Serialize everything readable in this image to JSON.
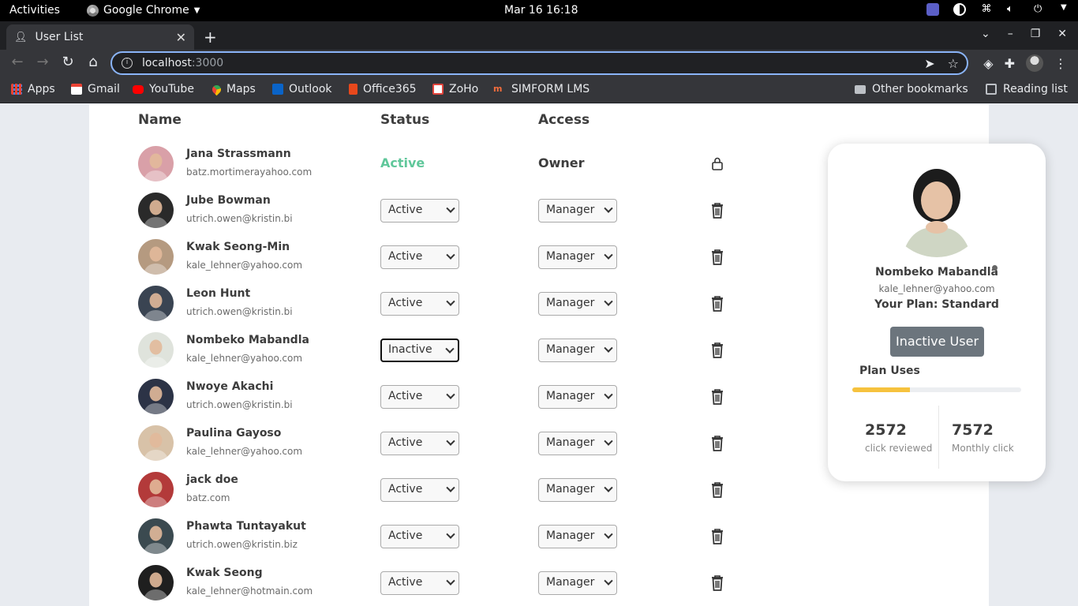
{
  "system_bar": {
    "activities": "Activities",
    "app_name": "Google Chrome",
    "datetime": "Mar 16  16:18"
  },
  "browser": {
    "tab_title": "User List",
    "url_host": "localhost",
    "url_port": ":3000",
    "bookmarks": [
      "Apps",
      "Gmail",
      "YouTube",
      "Maps",
      "Outlook",
      "Office365",
      "ZoHo",
      "SIMFORM LMS"
    ],
    "other_bookmarks": "Other bookmarks",
    "reading_list": "Reading list"
  },
  "table": {
    "headers": {
      "name": "Name",
      "status": "Status",
      "access": "Access"
    },
    "rows": [
      {
        "name": "Jana Strassmann",
        "email": "batz.mortimerayahoo.com",
        "status": "Active",
        "access": "Owner",
        "editable": false,
        "icon": "lock-icon",
        "avatar_color": "#d9a0a8"
      },
      {
        "name": "Jube Bowman",
        "email": "utrich.owen@kristin.bi",
        "status": "Active",
        "access": "Manager",
        "editable": true,
        "icon": "trash-icon",
        "avatar_color": "#2a2a2a"
      },
      {
        "name": "Kwak Seong-Min",
        "email": "kale_lehner@yahoo.com",
        "status": "Active",
        "access": "Manager",
        "editable": true,
        "icon": "trash-icon",
        "avatar_color": "#b59a80"
      },
      {
        "name": "Leon Hunt",
        "email": "utrich.owen@kristin.bi",
        "status": "Active",
        "access": "Manager",
        "editable": true,
        "icon": "trash-icon",
        "avatar_color": "#3a4452"
      },
      {
        "name": "Nombeko Mabandla",
        "email": "kale_lehner@yahoo.com",
        "status": "Inactive",
        "access": "Manager",
        "editable": true,
        "icon": "trash-icon",
        "avatar_color": "#dfe3dc"
      },
      {
        "name": "Nwoye Akachi",
        "email": "utrich.owen@kristin.bi",
        "status": "Active",
        "access": "Manager",
        "editable": true,
        "icon": "trash-icon",
        "avatar_color": "#2c3346"
      },
      {
        "name": "Paulina Gayoso",
        "email": "kale_lehner@yahoo.com",
        "status": "Active",
        "access": "Manager",
        "editable": true,
        "icon": "trash-icon",
        "avatar_color": "#d8c2a8"
      },
      {
        "name": "jack doe",
        "email": "batz.com",
        "status": "Active",
        "access": "Manager",
        "editable": true,
        "icon": "trash-icon",
        "avatar_color": "#b33a3a"
      },
      {
        "name": "Phawta Tuntayakut",
        "email": "utrich.owen@kristin.biz",
        "status": "Active",
        "access": "Manager",
        "editable": true,
        "icon": "trash-icon",
        "avatar_color": "#3b4a50"
      },
      {
        "name": "Kwak Seong",
        "email": "kale_lehner@hotmain.com",
        "status": "Active",
        "access": "Manager",
        "editable": true,
        "icon": "trash-icon",
        "avatar_color": "#1f1f1f"
      }
    ]
  },
  "profile_card": {
    "name": "Nombeko Mabandla",
    "email": "kale_lehner@yahoo.com",
    "plan": "Your Plan: Standard",
    "button": "Inactive User",
    "plan_uses_label": "Plan Uses",
    "plan_uses_fraction": 0.34,
    "stats": [
      {
        "value": "2572",
        "label": "click reviewed"
      },
      {
        "value": "7572",
        "label": "Monthly click"
      }
    ]
  },
  "colors": {
    "active_status": "#5fc79a",
    "progress": "#f6c23e",
    "button": "#6c757d",
    "focus_ring": "#8ab4f8"
  }
}
